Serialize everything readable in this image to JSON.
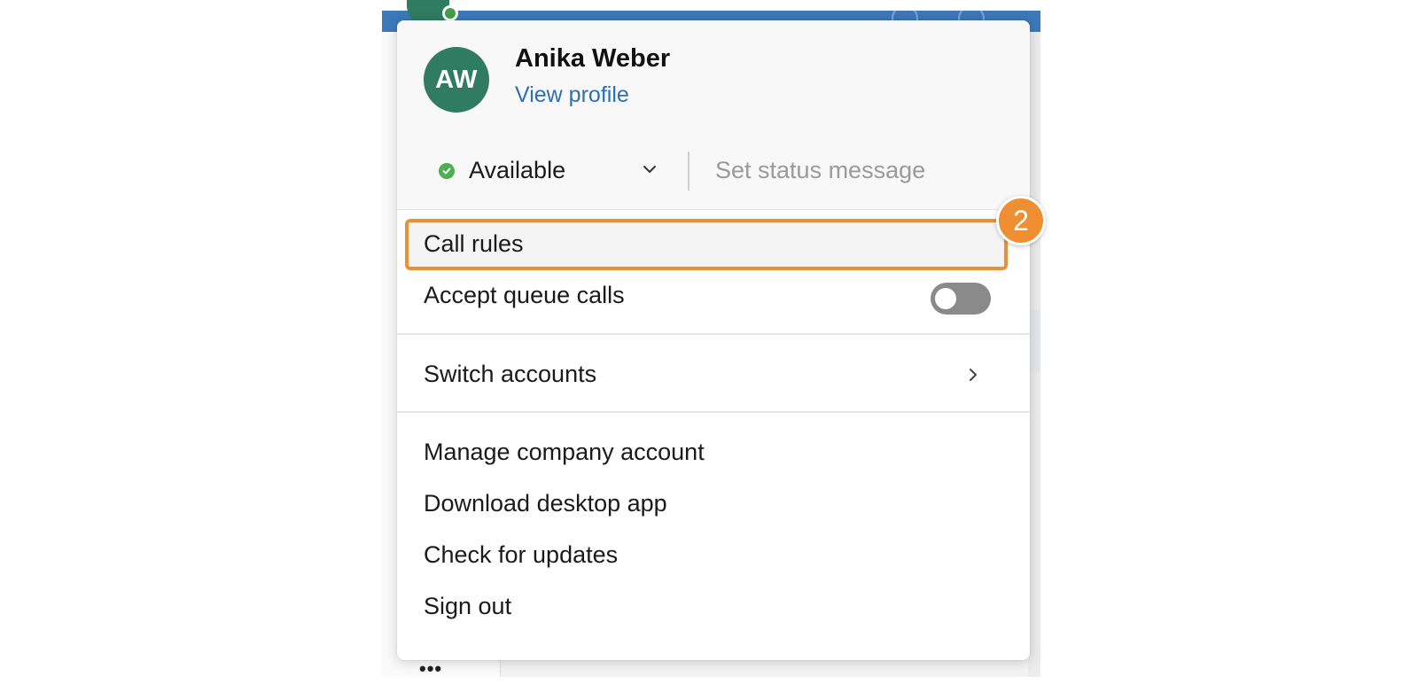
{
  "profile": {
    "initials": "AW",
    "name": "Anika Weber",
    "view_profile_label": "View profile"
  },
  "status": {
    "current": "Available",
    "status_color": "#4caf50",
    "message_placeholder": "Set status message"
  },
  "menu": {
    "call_rules_label": "Call rules",
    "accept_queue_calls_label": "Accept queue calls",
    "accept_queue_calls_enabled": false,
    "switch_accounts_label": "Switch accounts",
    "manage_company_label": "Manage company account",
    "download_app_label": "Download desktop app",
    "check_updates_label": "Check for updates",
    "sign_out_label": "Sign out"
  },
  "annotation": {
    "step_number": "2",
    "highlight_color": "#e89237"
  },
  "colors": {
    "avatar_bg": "#2f7c63",
    "link": "#2f6fb0",
    "app_bar": "#3d78b8"
  },
  "icons": {
    "status": "check-circle-icon",
    "dropdown": "chevron-down-icon",
    "submenu": "chevron-right-icon",
    "more": "ellipsis-icon"
  }
}
